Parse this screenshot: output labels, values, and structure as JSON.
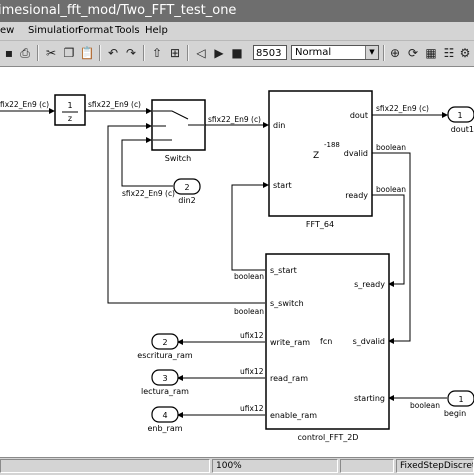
{
  "window": {
    "title": "imesional_fft_mod/Two_FFT_test_one"
  },
  "menu": {
    "items": [
      "ew",
      "Simulation",
      "Format",
      "Tools",
      "Help"
    ]
  },
  "toolbar": {
    "stop_time": "8503",
    "sim_mode": "Normal"
  },
  "blocks": {
    "delay": {
      "num": "1",
      "den": "z"
    },
    "switch": {
      "name": "Switch"
    },
    "fft": {
      "name": "FFT_64",
      "ports_in": [
        "din",
        "start"
      ],
      "ports_out": [
        "dout",
        "dvalid",
        "ready"
      ],
      "latency_exp": "-188",
      "latency_base": "Z"
    },
    "control": {
      "name": "control_FFT_2D",
      "fcn": "fcn",
      "ports_in": [
        "s_start",
        "s_switch",
        "write_ram",
        "read_ram",
        "enable_ram"
      ],
      "ports_out": [
        "s_ready",
        "s_dvalid",
        "starting"
      ]
    },
    "outports": [
      {
        "num": "1",
        "name": "dout1"
      },
      {
        "num": "2",
        "name": "escritura_ram"
      },
      {
        "num": "3",
        "name": "lectura_ram"
      },
      {
        "num": "4",
        "name": "enb_ram"
      }
    ],
    "inports": [
      {
        "num": "2",
        "name": "din2"
      },
      {
        "num": "1",
        "name": "begin"
      }
    ]
  },
  "signals": {
    "in_type": "fix22_En9 (c)",
    "delay_out": "sfix22_En9 (c)",
    "switch_out": "sfix22_En9 (c)",
    "fft_dout": "sfix22_En9 (c)",
    "din2_type": "sfix22_En9 (c)",
    "dvalid_type": "boolean",
    "ready_type": "boolean",
    "s_start_type": "boolean",
    "s_switch_type": "boolean",
    "write_type": "ufix12",
    "read_type": "ufix12",
    "enable_type": "ufix12",
    "begin_type": "boolean"
  },
  "status": {
    "zoom": "100%",
    "solver": "FixedStepDiscrete"
  }
}
